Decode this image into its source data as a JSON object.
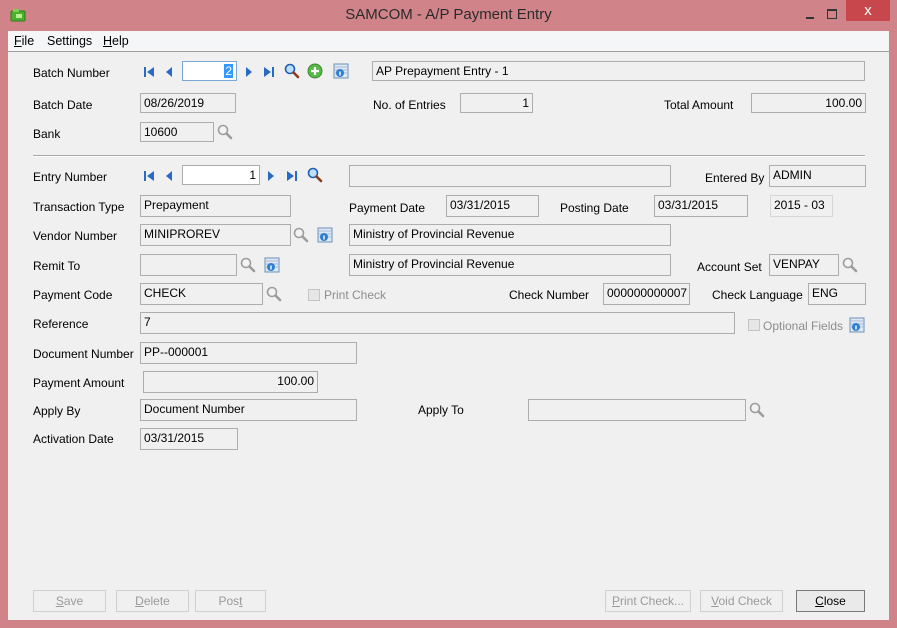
{
  "window": {
    "title": "SAMCOM - A/P Payment Entry",
    "close_glyph": "x",
    "accent_color": "#d08489",
    "close_color": "#c7474c"
  },
  "menu": {
    "items": [
      {
        "label": "File",
        "accel": "F",
        "rest": "ile"
      },
      {
        "label": "Settings",
        "accel": "",
        "rest": "Settings"
      },
      {
        "label": "Help",
        "accel": "H",
        "rest": "elp"
      }
    ]
  },
  "batch": {
    "number_label": "Batch Number",
    "number_value": "2",
    "description": "AP Prepayment Entry - 1",
    "date_label": "Batch Date",
    "date_value": "08/26/2019",
    "entries_label": "No. of Entries",
    "entries_value": "1",
    "total_label": "Total Amount",
    "total_value": "100.00",
    "bank_label": "Bank",
    "bank_value": "10600"
  },
  "entry": {
    "number_label": "Entry Number",
    "number_value": "1",
    "description": "",
    "entered_by_label": "Entered By",
    "entered_by_value": "ADMIN",
    "transaction_type_label": "Transaction Type",
    "transaction_type_value": "Prepayment",
    "payment_date_label": "Payment Date",
    "payment_date_value": "03/31/2015",
    "posting_date_label": "Posting Date",
    "posting_date_value": "03/31/2015",
    "fiscal_period_value": "2015 - 03",
    "vendor_label": "Vendor Number",
    "vendor_value": "MINIPROREV",
    "vendor_name": "Ministry of Provincial Revenue",
    "remit_label": "Remit To",
    "remit_value": "",
    "remit_name": "Ministry of Provincial Revenue",
    "account_set_label": "Account Set",
    "account_set_value": "VENPAY",
    "payment_code_label": "Payment Code",
    "payment_code_value": "CHECK",
    "print_check_label": "Print Check",
    "check_number_label": "Check Number",
    "check_number_value": "000000000007",
    "check_language_label": "Check Language",
    "check_language_value": "ENG",
    "reference_label": "Reference",
    "reference_value": "7",
    "optional_fields_label": "Optional Fields",
    "document_number_label": "Document Number",
    "document_number_value": "PP--000001",
    "payment_amount_label": "Payment Amount",
    "payment_amount_value": "100.00",
    "apply_by_label": "Apply By",
    "apply_by_value": "Document Number",
    "apply_to_label": "Apply To",
    "apply_to_value": "",
    "activation_date_label": "Activation Date",
    "activation_date_value": "03/31/2015"
  },
  "buttons": {
    "save": {
      "accel": "S",
      "rest": "ave"
    },
    "delete": {
      "accel": "D",
      "rest": "elete"
    },
    "post": {
      "pre": "Pos",
      "accel": "t"
    },
    "print_check": {
      "accel": "P",
      "rest": "rint Check..."
    },
    "void_check": {
      "accel": "V",
      "rest": "oid Check"
    },
    "close": {
      "accel": "C",
      "rest": "lose"
    }
  }
}
